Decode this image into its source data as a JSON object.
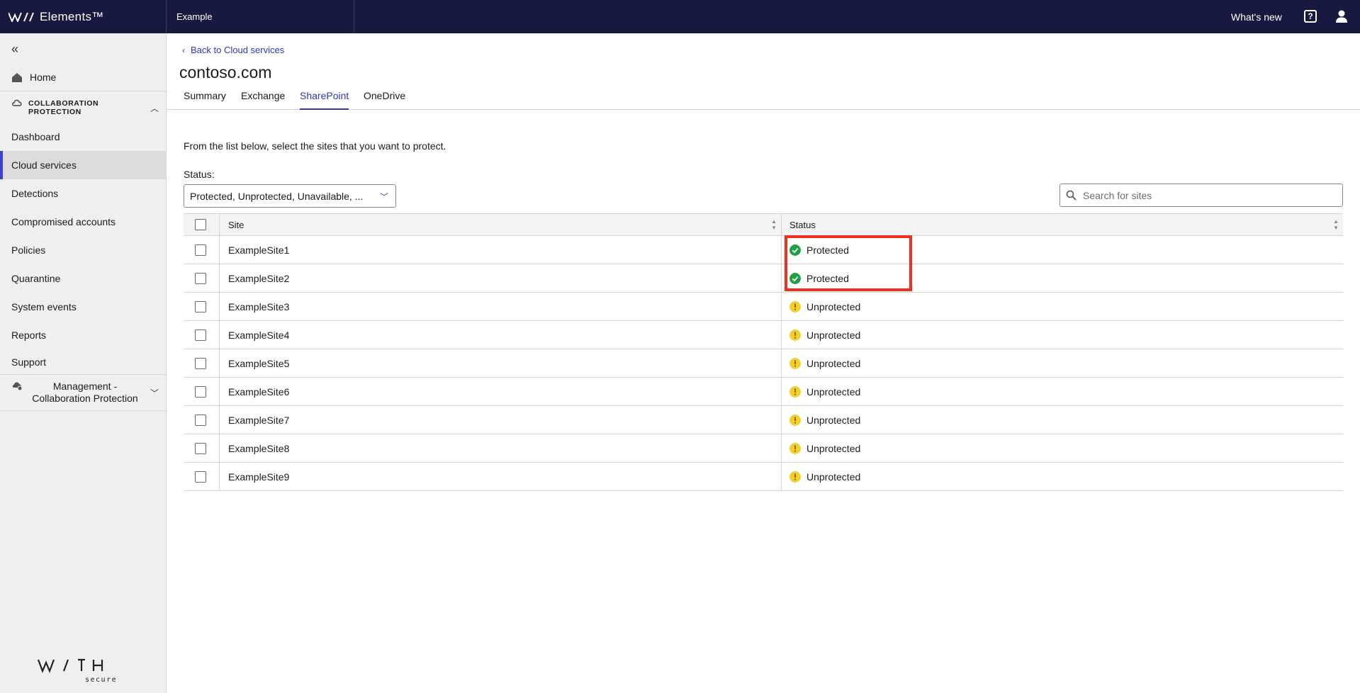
{
  "topbar": {
    "brand": "Elements™",
    "org": "Example",
    "whats_new": "What's new",
    "help_glyph": "?"
  },
  "sidebar": {
    "home": "Home",
    "section_title": "COLLABORATION PROTECTION",
    "items": [
      {
        "label": "Dashboard",
        "active": false
      },
      {
        "label": "Cloud services",
        "active": true
      },
      {
        "label": "Detections",
        "active": false
      },
      {
        "label": "Compromised accounts",
        "active": false
      },
      {
        "label": "Policies",
        "active": false
      },
      {
        "label": "Quarantine",
        "active": false
      },
      {
        "label": "System events",
        "active": false
      },
      {
        "label": "Reports",
        "active": false
      },
      {
        "label": "Support",
        "active": false
      }
    ],
    "management": "Management - Collaboration Protection",
    "logo_text": "WITH secure"
  },
  "main": {
    "back_link": "Back to Cloud services",
    "title": "contoso.com",
    "tabs": [
      {
        "label": "Summary",
        "active": false
      },
      {
        "label": "Exchange",
        "active": false
      },
      {
        "label": "SharePoint",
        "active": true
      },
      {
        "label": "OneDrive",
        "active": false
      }
    ],
    "intro": "From the list below, select the sites that you want to protect.",
    "status_filter_label": "Status:",
    "status_filter_value": "Protected, Unprotected, Unavailable, ...",
    "search_placeholder": "Search for sites"
  },
  "table": {
    "headers": {
      "site": "Site",
      "status": "Status"
    },
    "rows": [
      {
        "site": "ExampleSite1",
        "status": "Protected"
      },
      {
        "site": "ExampleSite2",
        "status": "Protected"
      },
      {
        "site": "ExampleSite3",
        "status": "Unprotected"
      },
      {
        "site": "ExampleSite4",
        "status": "Unprotected"
      },
      {
        "site": "ExampleSite5",
        "status": "Unprotected"
      },
      {
        "site": "ExampleSite6",
        "status": "Unprotected"
      },
      {
        "site": "ExampleSite7",
        "status": "Unprotected"
      },
      {
        "site": "ExampleSite8",
        "status": "Unprotected"
      },
      {
        "site": "ExampleSite9",
        "status": "Unprotected"
      }
    ]
  },
  "colors": {
    "topbar": "#17193f",
    "accent": "#3036b8",
    "protected": "#1ea044",
    "unprotected": "#f2d02b",
    "highlight": "#f0301a"
  }
}
